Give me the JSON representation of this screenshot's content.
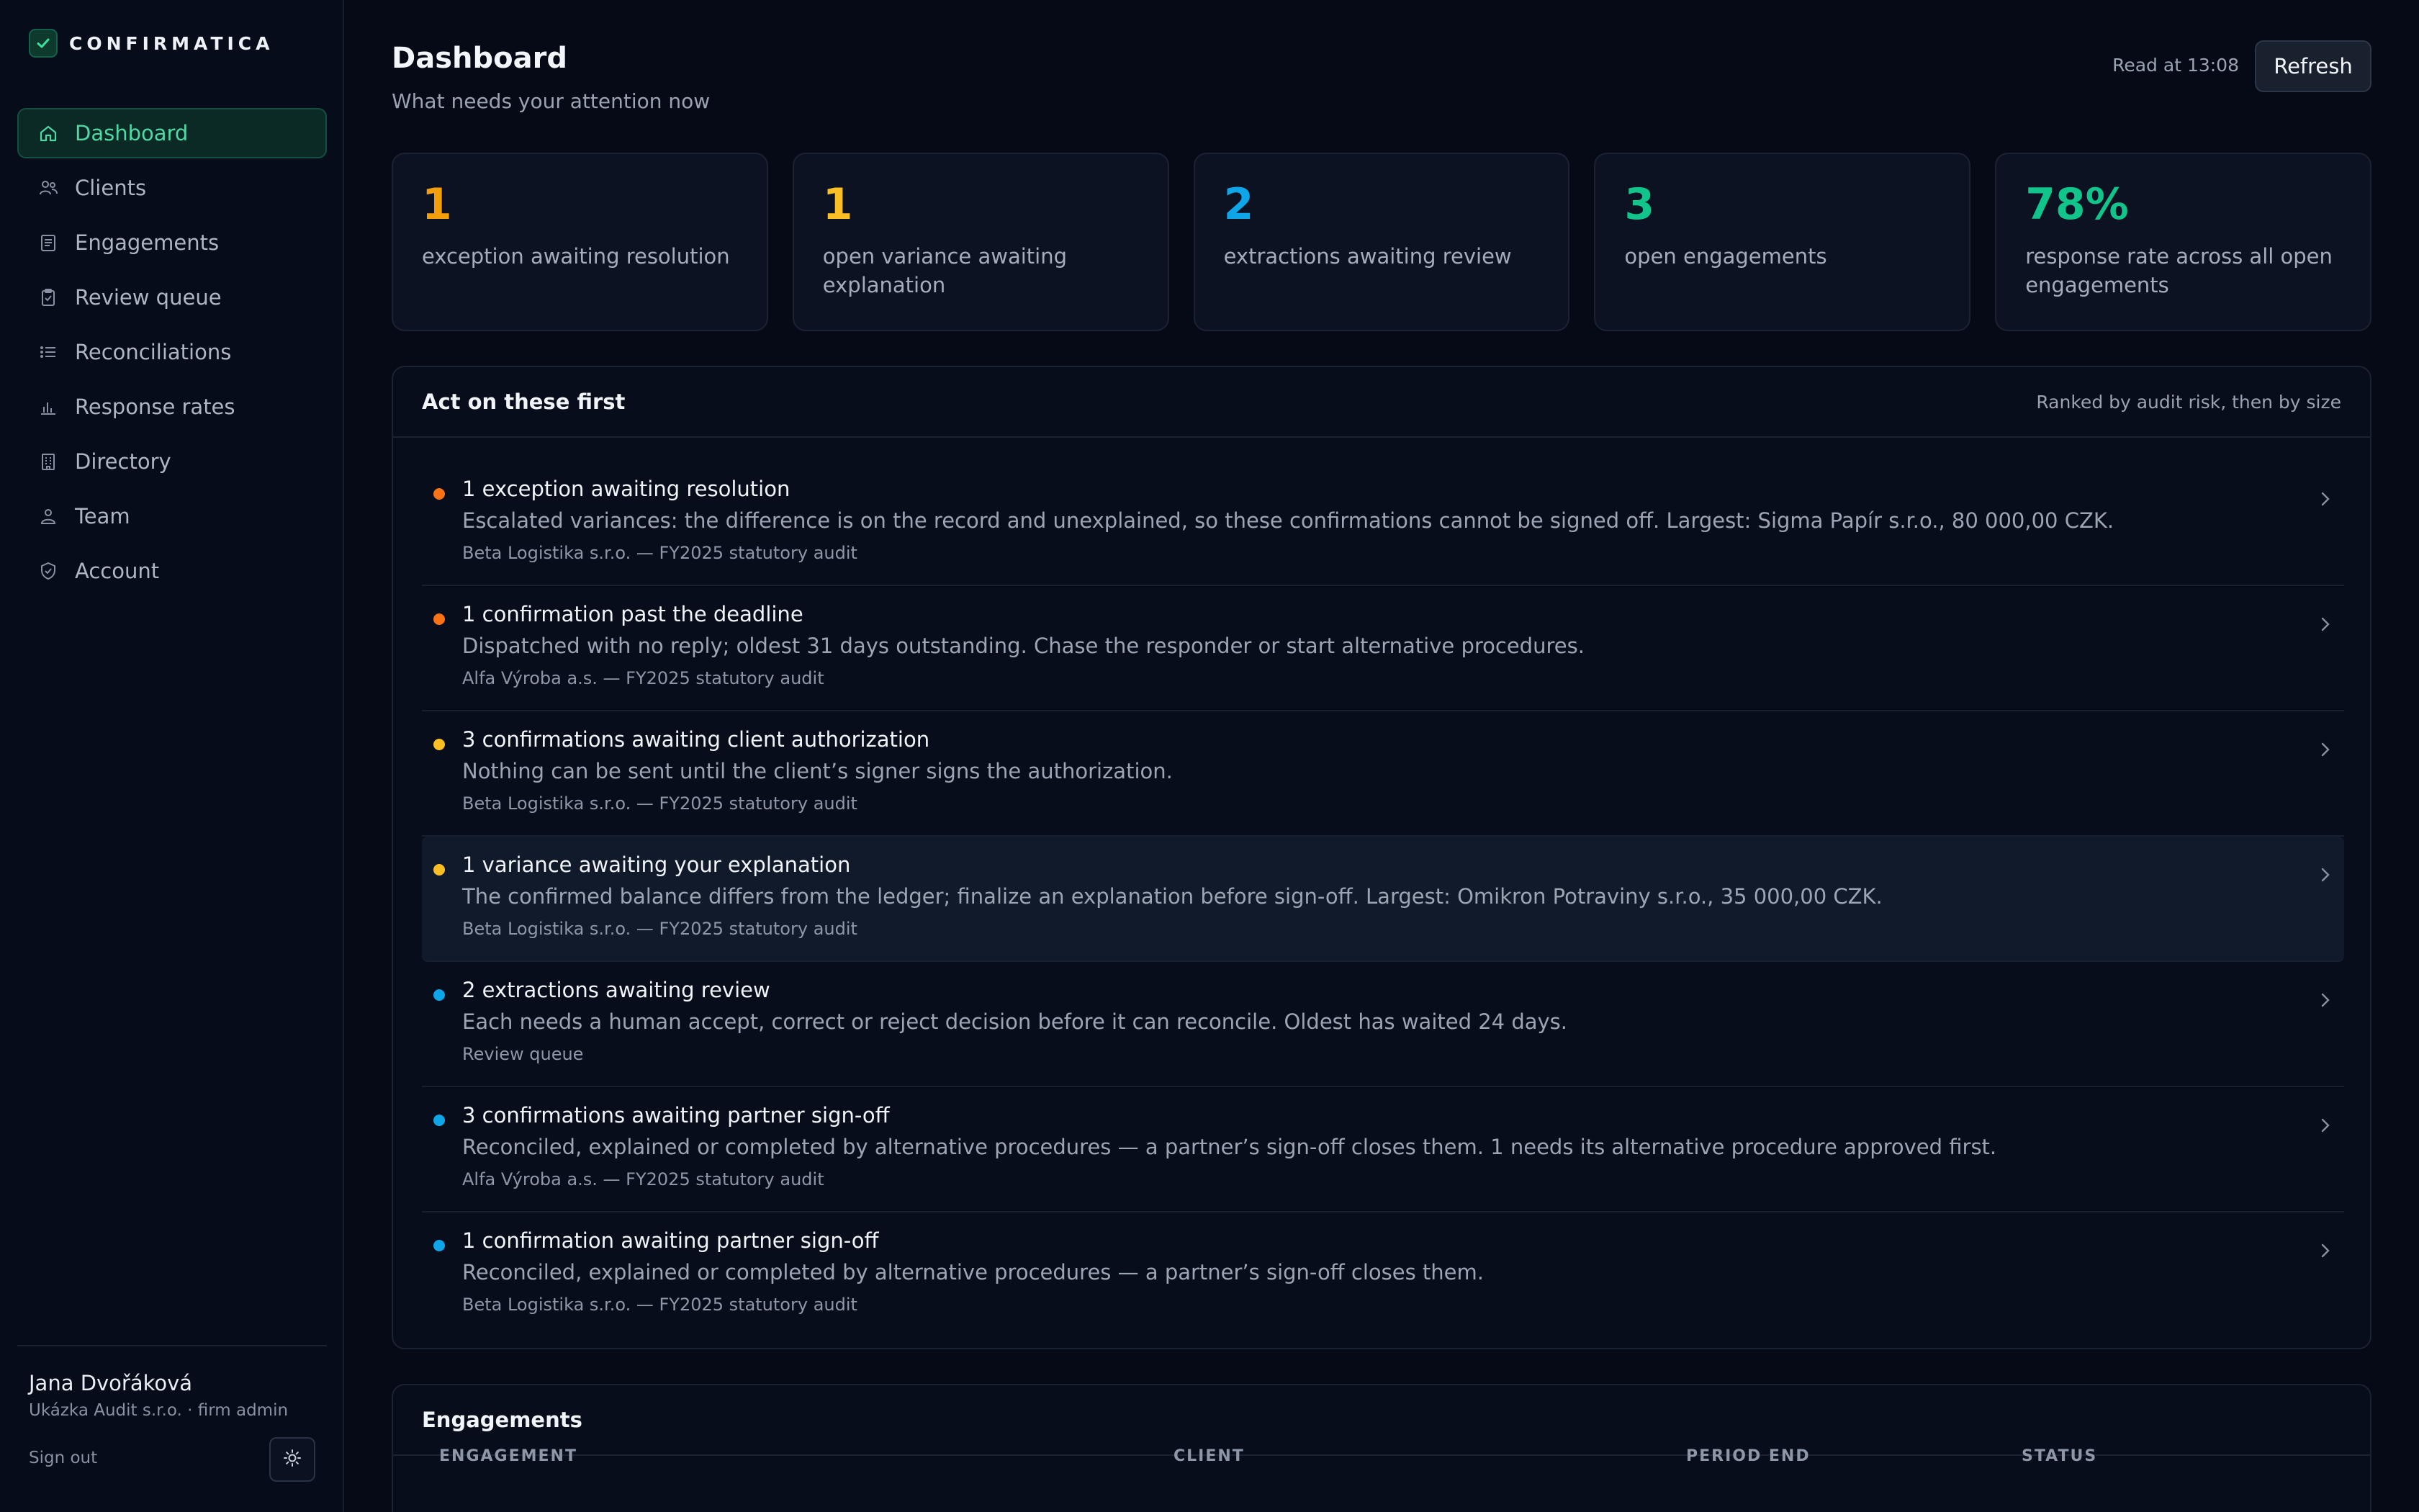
{
  "brand": {
    "name": "CONFIRMATICA"
  },
  "nav": [
    {
      "label": "Dashboard",
      "icon": "home-icon",
      "active": true
    },
    {
      "label": "Clients",
      "icon": "users-icon"
    },
    {
      "label": "Engagements",
      "icon": "document-icon"
    },
    {
      "label": "Review queue",
      "icon": "clipboard-check-icon"
    },
    {
      "label": "Reconciliations",
      "icon": "list-icon"
    },
    {
      "label": "Response rates",
      "icon": "bar-chart-icon"
    },
    {
      "label": "Directory",
      "icon": "building-icon"
    },
    {
      "label": "Team",
      "icon": "team-icon"
    },
    {
      "label": "Account",
      "icon": "shield-check-icon"
    }
  ],
  "user": {
    "name": "Jana Dvořáková",
    "role": "Ukázka Audit s.r.o. · firm admin",
    "sign_out": "Sign out",
    "theme_icon": "sun-icon"
  },
  "header": {
    "title": "Dashboard",
    "subtitle": "What needs your attention now",
    "read_at": "Read at 13:08",
    "refresh": "Refresh"
  },
  "stats": [
    {
      "value": "1",
      "label": "exception awaiting resolution",
      "color": "#f59e0b"
    },
    {
      "value": "1",
      "label": "open variance awaiting explanation",
      "color": "#fbbf24"
    },
    {
      "value": "2",
      "label": "extractions awaiting review",
      "color": "#0ea5e9"
    },
    {
      "value": "3",
      "label": "open engagements",
      "color": "#10c48a"
    },
    {
      "value": "78%",
      "label": "response rate across all open engagements",
      "color": "#10c48a"
    }
  ],
  "act": {
    "title": "Act on these first",
    "note": "Ranked by audit risk, then by size",
    "items": [
      {
        "title": "1 exception awaiting resolution",
        "desc": "Escalated variances: the difference is on the record and unexplained, so these confirmations cannot be signed off. Largest: Sigma Papír s.r.o., 80 000,00 CZK.",
        "meta": "Beta Logistika s.r.o. — FY2025 statutory audit",
        "dot": "#f97316"
      },
      {
        "title": "1 confirmation past the deadline",
        "desc": "Dispatched with no reply; oldest 31 days outstanding. Chase the responder or start alternative procedures.",
        "meta": "Alfa Výroba a.s. — FY2025 statutory audit",
        "dot": "#f97316"
      },
      {
        "title": "3 confirmations awaiting client authorization",
        "desc": "Nothing can be sent until the client’s signer signs the authorization.",
        "meta": "Beta Logistika s.r.o. — FY2025 statutory audit",
        "dot": "#fbbf24"
      },
      {
        "title": "1 variance awaiting your explanation",
        "desc": "The confirmed balance differs from the ledger; finalize an explanation before sign-off. Largest: Omikron Potraviny s.r.o., 35 000,00 CZK.",
        "meta": "Beta Logistika s.r.o. — FY2025 statutory audit",
        "dot": "#fbbf24"
      },
      {
        "title": "2 extractions awaiting review",
        "desc": "Each needs a human accept, correct or reject decision before it can reconcile. Oldest has waited 24 days.",
        "meta": "Review queue",
        "dot": "#0ea5e9"
      },
      {
        "title": "3 confirmations awaiting partner sign-off",
        "desc": "Reconciled, explained or completed by alternative procedures — a partner’s sign-off closes them. 1 needs its alternative procedure approved first.",
        "meta": "Alfa Výroba a.s. — FY2025 statutory audit",
        "dot": "#0ea5e9"
      },
      {
        "title": "1 confirmation awaiting partner sign-off",
        "desc": "Reconciled, explained or completed by alternative procedures — a partner’s sign-off closes them.",
        "meta": "Beta Logistika s.r.o. — FY2025 statutory audit",
        "dot": "#0ea5e9"
      }
    ]
  },
  "engagements": {
    "title": "Engagements",
    "columns": [
      "ENGAGEMENT",
      "CLIENT",
      "PERIOD END",
      "STATUS"
    ]
  }
}
